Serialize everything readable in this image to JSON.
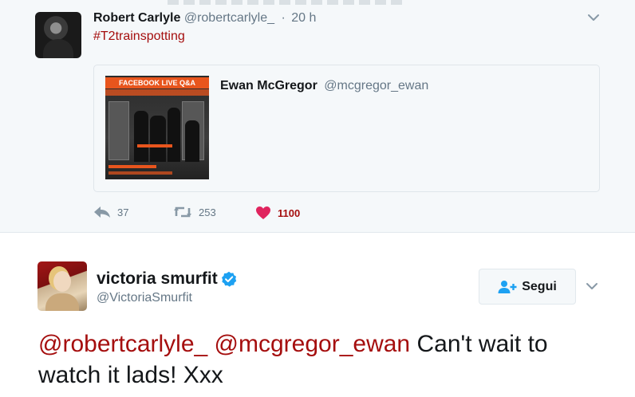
{
  "parent_tweet": {
    "author_name": "Robert Carlyle",
    "author_handle": "@robertcarlyle_",
    "separator": "·",
    "time": "20 h",
    "text": "#T2trainspotting",
    "quoted": {
      "author_name": "Ewan McGregor",
      "author_handle": "@mcgregor_ewan",
      "image_banner": "FACEBOOK LIVE Q&A"
    },
    "actions": {
      "reply_count": "37",
      "retweet_count": "253",
      "like_count": "1100"
    }
  },
  "main_tweet": {
    "author_name": "victoria smurfit",
    "author_handle": "@VictoriaSmurfit",
    "follow_label": "Segui",
    "mention_1": "@robertcarlyle_",
    "mention_2": "@mcgregor_ewan",
    "text_rest": "Can't wait to watch it lads! Xxx"
  },
  "colors": {
    "link_accent": "#a50e0e",
    "muted_text": "#657786",
    "verified_blue": "#1da1f2",
    "like_red": "#e0245e"
  },
  "icons": {
    "reply": "reply-icon",
    "retweet": "retweet-icon",
    "like": "heart-icon",
    "verified": "verified-badge-icon",
    "follow": "add-user-icon",
    "menu": "chevron-down-icon"
  }
}
